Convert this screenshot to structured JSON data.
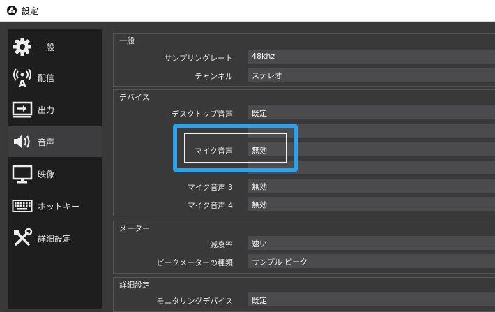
{
  "window": {
    "title": "設定"
  },
  "sidebar": {
    "items": [
      {
        "label": "一般",
        "icon": "gear-icon"
      },
      {
        "label": "配信",
        "icon": "broadcast-icon"
      },
      {
        "label": "出力",
        "icon": "output-icon"
      },
      {
        "label": "音声",
        "icon": "speaker-icon",
        "active": true
      },
      {
        "label": "映像",
        "icon": "monitor-icon"
      },
      {
        "label": "ホットキー",
        "icon": "keyboard-icon"
      },
      {
        "label": "詳細設定",
        "icon": "tools-icon"
      }
    ]
  },
  "general": {
    "title": "一般",
    "sample_rate_label": "サンプリングレート",
    "sample_rate_value": "48khz",
    "channels_label": "チャンネル",
    "channels_value": "ステレオ"
  },
  "devices": {
    "title": "デバイス",
    "desktop_audio_label": "デスクトップ音声",
    "desktop_audio_value": "既定",
    "mic_label": "マイク音声",
    "mic_value": "無効",
    "mic3_label": "マイク音声 3",
    "mic3_value": "無効",
    "mic4_label": "マイク音声 4",
    "mic4_value": "無効"
  },
  "meters": {
    "title": "メーター",
    "decay_label": "減衰率",
    "decay_value": "速い",
    "peak_label": "ピークメーターの種類",
    "peak_value": "サンプル ピーク"
  },
  "advanced": {
    "title": "詳細設定",
    "monitoring_label": "モニタリングデバイス",
    "monitoring_value": "既定"
  },
  "colors": {
    "highlight": "#2ea0ec",
    "sidebar_bg": "#1f1e1f",
    "panel_bg": "#3a393a",
    "field_bg": "#4b4a4c"
  }
}
